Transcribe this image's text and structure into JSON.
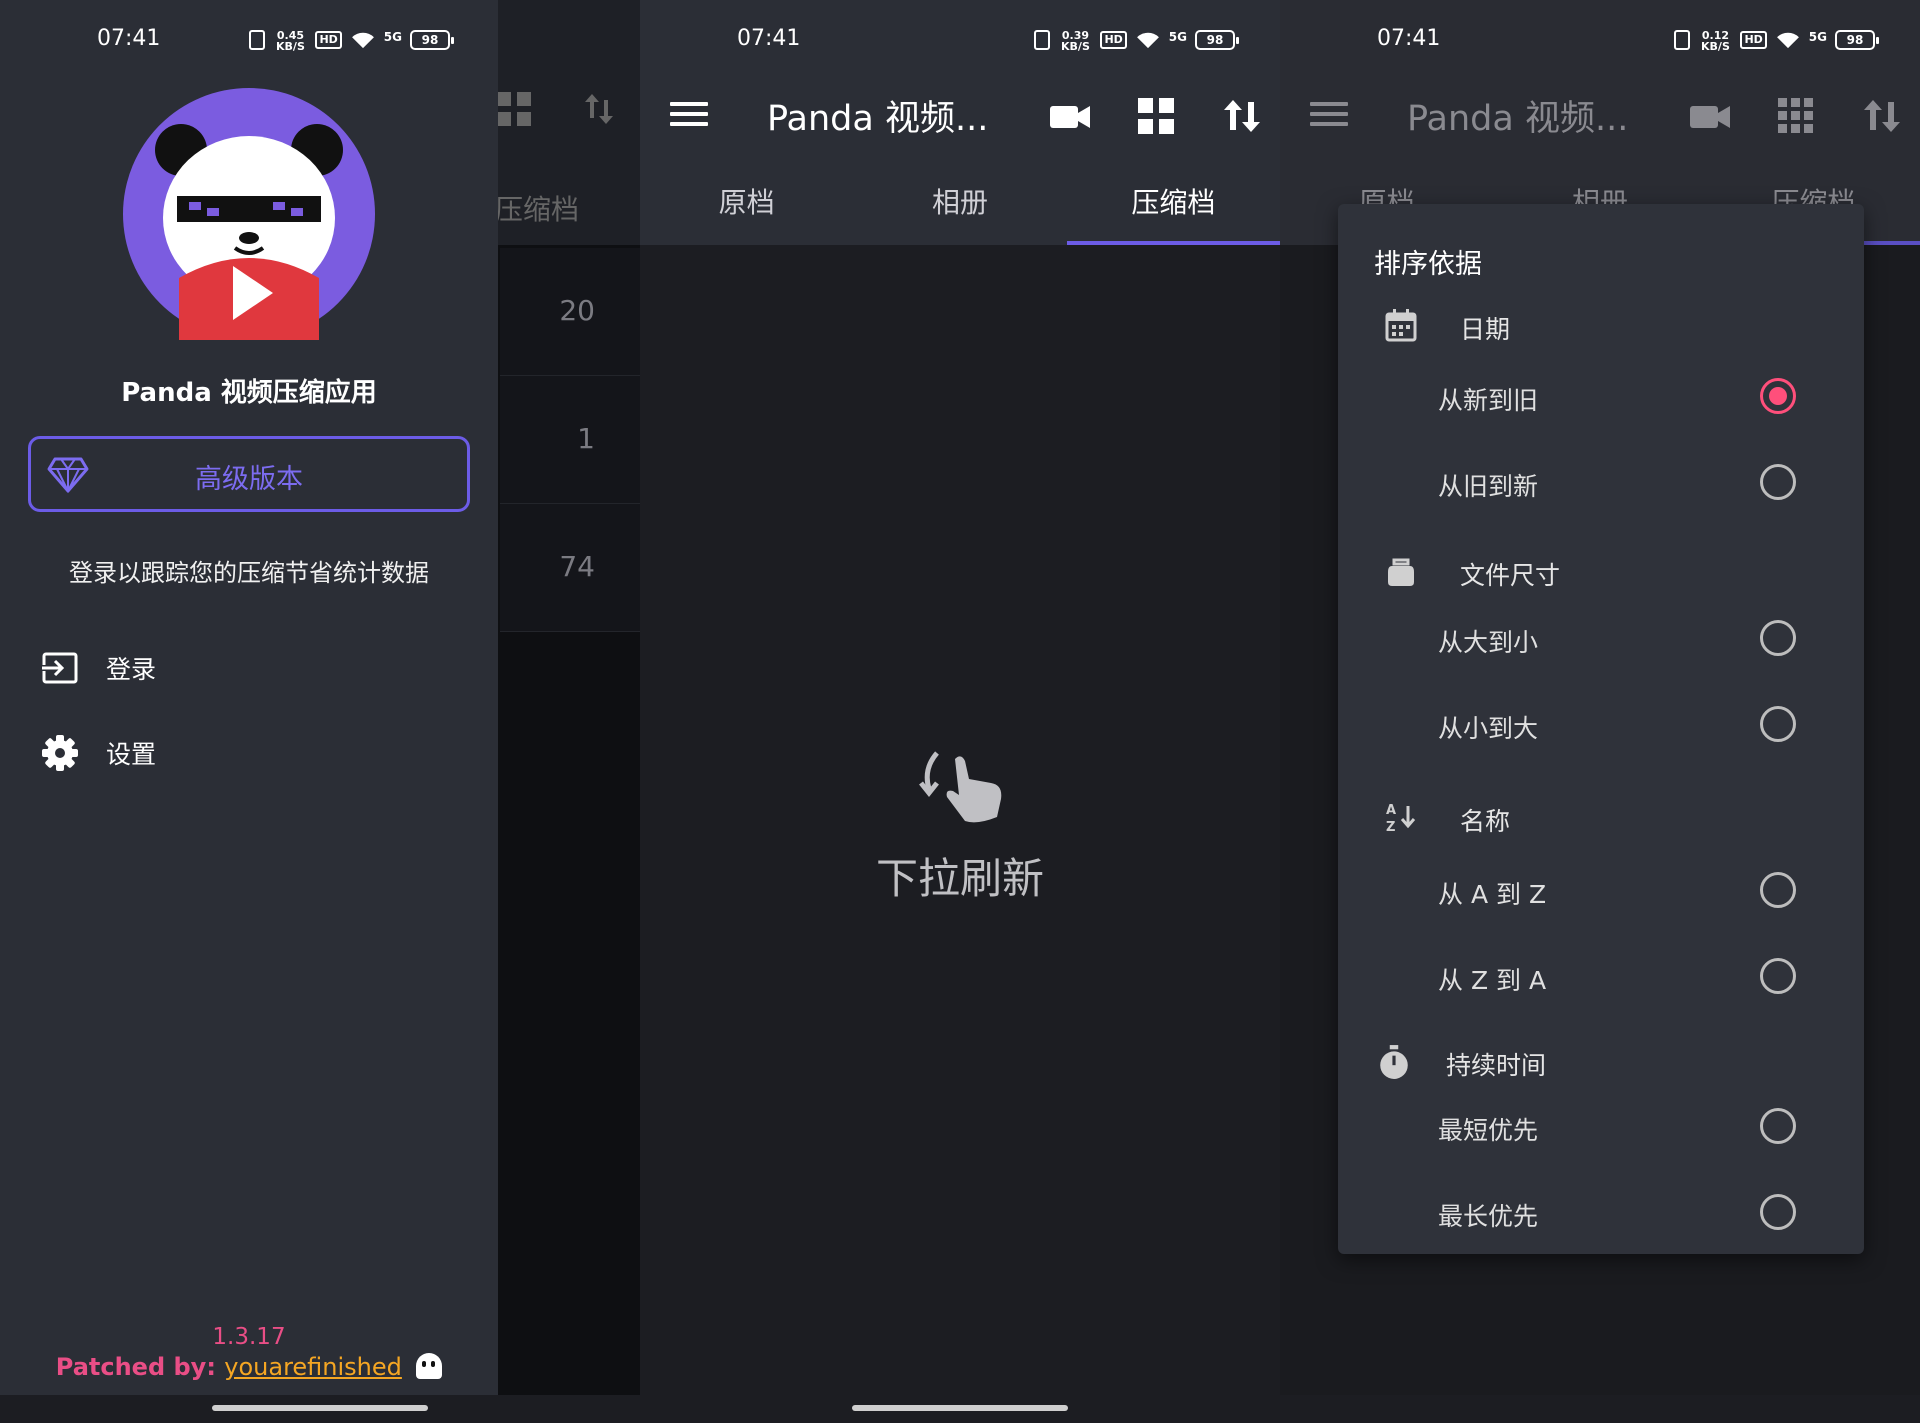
{
  "status": {
    "time": "07:41",
    "p1_speed": "0.45 KB/S",
    "p2_speed": "0.39 KB/S",
    "p3_speed": "0.12 KB/S",
    "hd": "HD",
    "net": "5G",
    "battery": "98"
  },
  "appbar": {
    "title": "Panda 视频...",
    "tabs": [
      "原档",
      "相册",
      "压缩档"
    ]
  },
  "drawer": {
    "app_name": "Panda 视频压缩应用",
    "premium_label": "高级版本",
    "login_hint": "登录以跟踪您的压缩节省统计数据",
    "items": [
      {
        "label": "登录",
        "icon": "login-icon"
      },
      {
        "label": "设置",
        "icon": "gear-icon"
      }
    ],
    "version": "1.3.17",
    "patched_prefix": "Patched by: ",
    "patched_author": "youarefinished"
  },
  "background_list": {
    "tab": "压缩档",
    "rows": [
      "20",
      "1",
      "74"
    ]
  },
  "empty_state": {
    "text": "下拉刷新"
  },
  "sort_sheet": {
    "title": "排序依据",
    "groups": [
      {
        "label": "日期",
        "icon": "calendar-icon",
        "options": [
          {
            "label": "从新到旧",
            "selected": true
          },
          {
            "label": "从旧到新",
            "selected": false
          }
        ]
      },
      {
        "label": "文件尺寸",
        "icon": "weight-icon",
        "options": [
          {
            "label": "从大到小",
            "selected": false
          },
          {
            "label": "从小到大",
            "selected": false
          }
        ]
      },
      {
        "label": "名称",
        "icon": "sort-alpha-icon",
        "options": [
          {
            "label": "从 A 到 Z",
            "selected": false
          },
          {
            "label": "从 Z 到 A",
            "selected": false
          }
        ]
      },
      {
        "label": "持续时间",
        "icon": "stopwatch-icon",
        "options": [
          {
            "label": "最短优先",
            "selected": false
          },
          {
            "label": "最长优先",
            "selected": false
          }
        ]
      }
    ]
  },
  "colors": {
    "accent": "#6c5ce7",
    "radio_selected": "#ff4f7b",
    "patched": "#e94e86",
    "author": "#f5a623"
  }
}
